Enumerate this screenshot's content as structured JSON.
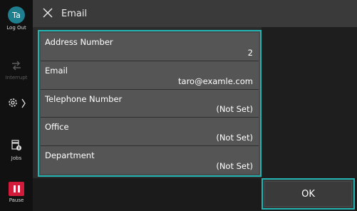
{
  "header": {
    "title": "Email",
    "close_icon": "close-icon"
  },
  "sidebar": {
    "avatar_initials": "Ta",
    "logout_label": "Log Out",
    "interrupt_label": "Interrupt",
    "jobs_label": "Jobs",
    "pause_label": "Pause"
  },
  "fields": [
    {
      "label": "Address Number",
      "value": "2"
    },
    {
      "label": "Email",
      "value": "taro@examle.com"
    },
    {
      "label": "Telephone Number",
      "value": "(Not Set)"
    },
    {
      "label": "Office",
      "value": "(Not Set)"
    },
    {
      "label": "Department",
      "value": "(Not Set)"
    }
  ],
  "footer": {
    "ok_label": "OK"
  },
  "colors": {
    "accent": "#22b3b3",
    "pause": "#d21b3a",
    "avatar": "#1f7f8f"
  }
}
